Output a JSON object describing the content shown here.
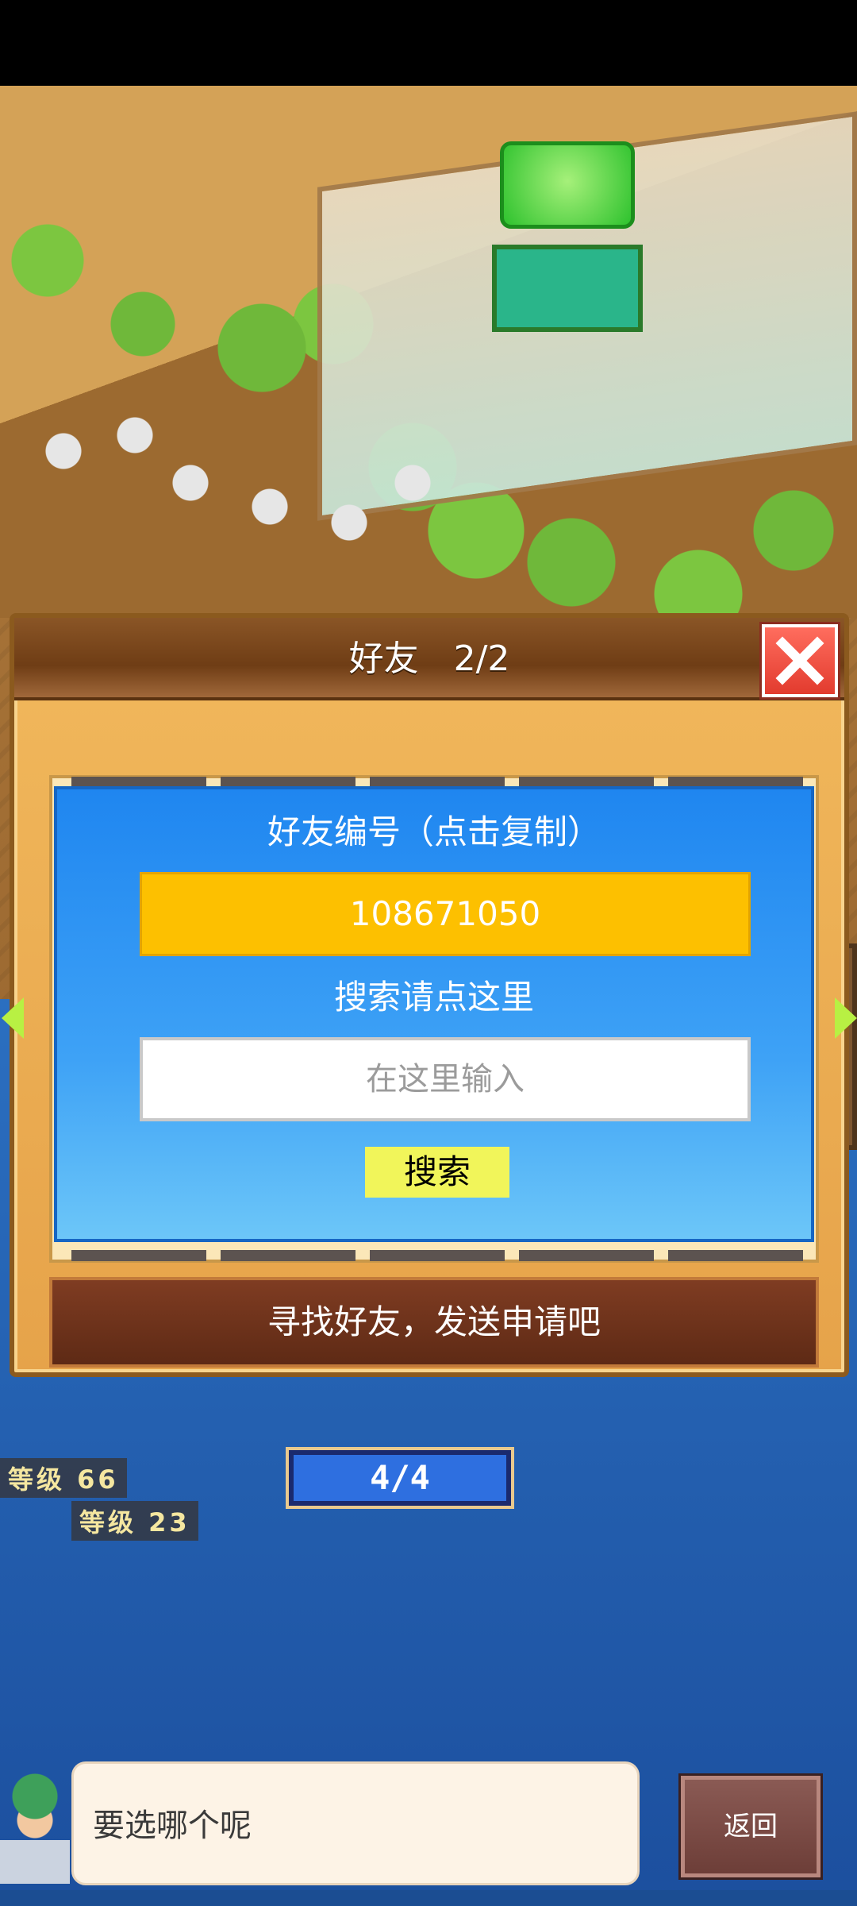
{
  "dialog": {
    "title": "好友　2/2",
    "id_label": "好友编号（点击复制）",
    "friend_id": "108671050",
    "search_label": "搜索请点这里",
    "search_placeholder": "在这里输入",
    "search_button": "搜索",
    "find_friends_button": "寻找好友，发送申请吧"
  },
  "world": {
    "level_label_1": "等级",
    "level_value_1": "66",
    "level_label_2": "等级",
    "level_value_2": "23",
    "capacity": "4/4"
  },
  "footer": {
    "hint": "要选哪个呢",
    "back_button": "返回"
  },
  "colors": {
    "panel_blue": "#1f86f0",
    "id_field_yellow": "#fdc000",
    "close_red": "#e23b2e",
    "search_button_yellow": "#f1f55a",
    "find_button_brown": "#6e3219"
  },
  "icons": {
    "close": "close-x-icon",
    "prev": "arrow-left-icon",
    "next": "arrow-right-icon"
  }
}
